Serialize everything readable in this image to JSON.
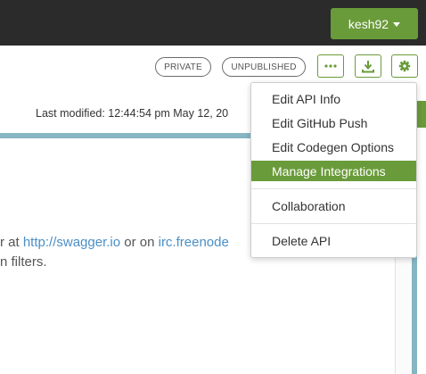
{
  "topbar": {
    "username": "kesh92"
  },
  "badges": {
    "private": "PRIVATE",
    "unpublished": "UNPUBLISHED"
  },
  "toolbar": {
    "more_icon": "ellipsis-icon",
    "download_icon": "download-icon",
    "settings_icon": "gear-icon"
  },
  "meta": {
    "last_modified": "Last modified: 12:44:54 pm May 12, 20"
  },
  "content": {
    "line1_prefix": "r at ",
    "link1": "http://swagger.io",
    "line1_middle": " or on ",
    "link2": "irc.freenode",
    "line2": "n filters."
  },
  "dropdown": {
    "items": [
      {
        "label": "Edit API Info"
      },
      {
        "label": "Edit GitHub Push"
      },
      {
        "label": "Edit Codegen Options"
      },
      {
        "label": "Manage Integrations",
        "active": true
      },
      {
        "label": "Collaboration"
      },
      {
        "label": "Delete API"
      }
    ]
  },
  "colors": {
    "accent": "#6a9b3a",
    "topbar": "#2b2b2b",
    "border_blue": "#86b6c4",
    "link": "#4a8fc7"
  }
}
